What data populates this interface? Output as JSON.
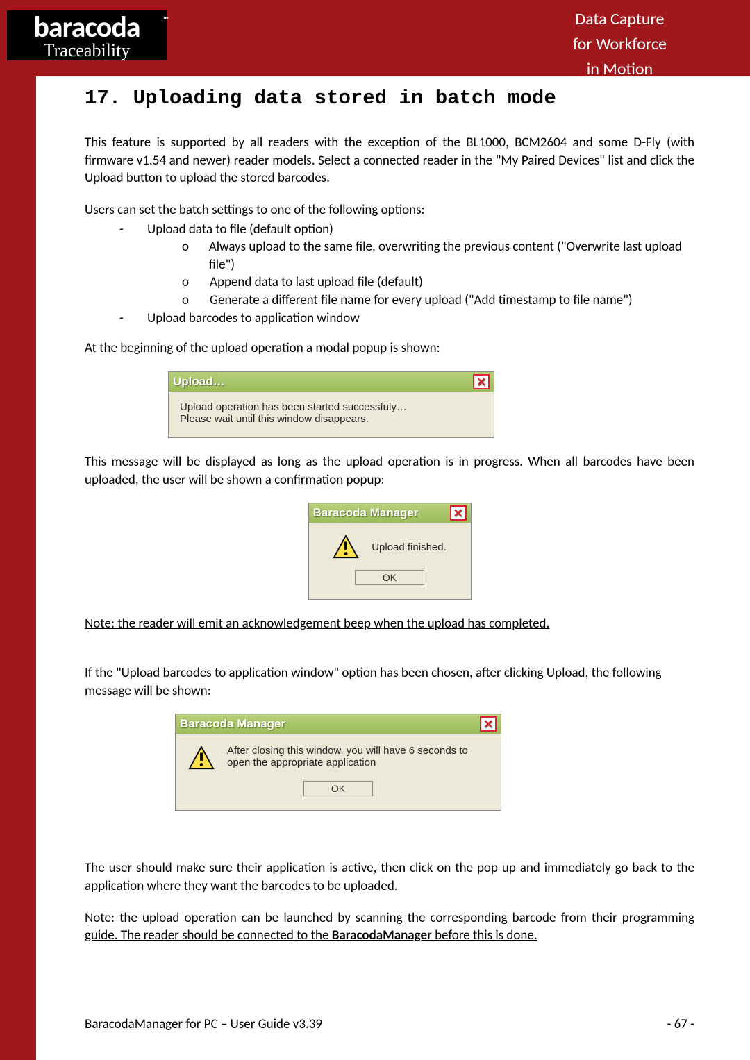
{
  "brand": {
    "name": "baracoda",
    "tm": "™",
    "sub": "Traceability"
  },
  "tagline": {
    "l1": "Data Capture",
    "l2": "for Workforce",
    "l3": "in Motion"
  },
  "section": {
    "num": "17.",
    "title": "Uploading data stored in batch mode"
  },
  "p1": "This feature is supported by all readers with the exception of the BL1000, BCM2604 and some D-Fly (with firmware v1.54 and newer) reader models. Select a connected reader in the \"My Paired Devices\" list and click the Upload button to upload the stored barcodes.",
  "p2": "Users can set the batch settings to one of the following options:",
  "bullets": {
    "a": "Upload data to file (default option)",
    "a1": "Always upload to the same file, overwriting the previous content (\"Overwrite last upload file\")",
    "a2": "Append data to last upload file (default)",
    "a3": "Generate a different file name for every upload (\"Add timestamp to file name\")",
    "b": "Upload barcodes to application window"
  },
  "p3": "At the beginning of the upload operation a modal popup is shown:",
  "dialog1": {
    "title": "Upload…",
    "line1": "Upload operation has been started successfuly…",
    "line2": "Please wait until this window disappears."
  },
  "p4": "This message will be displayed as long as the upload operation is in progress. When all barcodes have been uploaded, the user will be shown a confirmation popup:",
  "dialog2": {
    "title": "Baracoda Manager",
    "msg": "Upload finished.",
    "ok": "OK"
  },
  "note1": "Note: the reader will emit an acknowledgement beep when the upload has completed.",
  "p5": "If the \"Upload barcodes to application window\" option has been chosen, after clicking Upload, the following message will be shown:",
  "dialog3": {
    "title": "Baracoda Manager",
    "msg": "After closing this window, you will have 6 seconds to open the appropriate application",
    "ok": "OK"
  },
  "p6": "The user should make sure their application is active, then click on the pop up and immediately go back to the application where they want the barcodes to be uploaded.",
  "note2a": "Note: the upload operation can be launched by scanning the corresponding barcode from their programming guide. The reader should be connected to the ",
  "note2b": "BaracodaManager",
  "note2c": " before this is done.",
  "footer": {
    "left": "BaracodaManager for PC – User Guide v3.39",
    "right": "- 67 -"
  }
}
